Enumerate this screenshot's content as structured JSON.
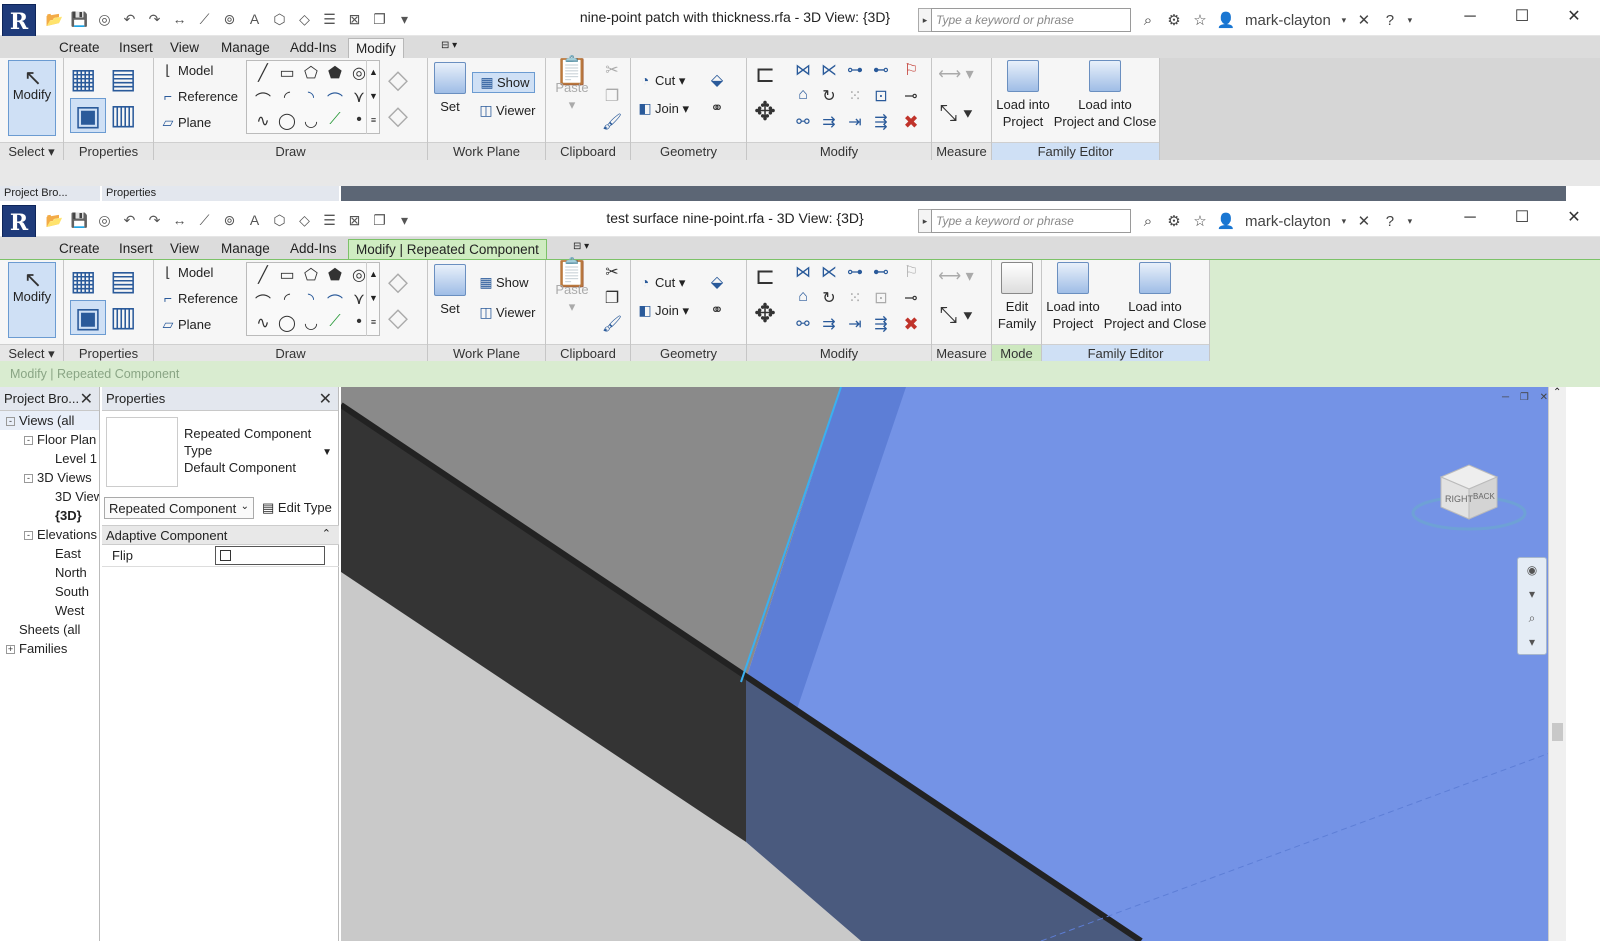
{
  "user": "mark-clayton",
  "search_placeholder": "Type a keyword or phrase",
  "qat_icons": [
    "open-icon",
    "save-icon",
    "sync-icon",
    "undo-icon",
    "redo-icon",
    "measure-icon",
    "dimension-icon",
    "tag-icon",
    "text-icon",
    "3d-view-icon",
    "section-icon",
    "thin-lines-icon",
    "close-hidden-icon",
    "switch-windows-icon",
    "customize-icon"
  ],
  "window1": {
    "title": "nine-point patch with thickness.rfa - 3D View: {3D}",
    "tabs": [
      "Create",
      "Insert",
      "View",
      "Manage",
      "Add-Ins",
      "Modify"
    ],
    "active_tab": "Modify",
    "browser_title": "Project Bro...",
    "properties_title": "Properties"
  },
  "window2": {
    "title": "test surface nine-point.rfa - 3D View: {3D}",
    "tabs": [
      "Create",
      "Insert",
      "View",
      "Manage",
      "Add-Ins"
    ],
    "active_tab": "Modify | Repeated Component",
    "options_bar": "Modify | Repeated Component",
    "browser_title": "Project Bro...",
    "properties_title": "Properties"
  },
  "ribbon": {
    "select": {
      "button": "Modify",
      "panel": "Select"
    },
    "properties": {
      "panel": "Properties"
    },
    "draw": {
      "panel": "Draw",
      "model": "Model",
      "reference": "Reference",
      "plane": "Plane"
    },
    "workplane": {
      "panel": "Work Plane",
      "set": "Set",
      "show": "Show",
      "viewer": "Viewer"
    },
    "clipboard": {
      "panel": "Clipboard",
      "paste": "Paste"
    },
    "geometry": {
      "panel": "Geometry",
      "cut": "Cut",
      "join": "Join"
    },
    "modify": {
      "panel": "Modify"
    },
    "measure": {
      "panel": "Measure"
    },
    "mode": {
      "panel": "Mode",
      "edit_family_1": "Edit",
      "edit_family_2": "Family"
    },
    "family_editor": {
      "panel": "Family Editor",
      "load_1": "Load into",
      "load_2": "Project",
      "load_close_1": "Load into",
      "load_close_2": "Project and Close"
    }
  },
  "project_browser": {
    "items": [
      {
        "label": "Views (all",
        "level": 0,
        "exp": "-"
      },
      {
        "label": "Floor Plan",
        "level": 1,
        "exp": "-"
      },
      {
        "label": "Level 1",
        "level": 2,
        "exp": ""
      },
      {
        "label": "3D Views",
        "level": 1,
        "exp": "-"
      },
      {
        "label": "3D View",
        "level": 2,
        "exp": ""
      },
      {
        "label": "{3D}",
        "level": 2,
        "exp": ""
      },
      {
        "label": "Elevations",
        "level": 1,
        "exp": "-"
      },
      {
        "label": "East",
        "level": 2,
        "exp": ""
      },
      {
        "label": "North",
        "level": 2,
        "exp": ""
      },
      {
        "label": "South",
        "level": 2,
        "exp": ""
      },
      {
        "label": "West",
        "level": 2,
        "exp": ""
      },
      {
        "label": "Sheets (all",
        "level": 0,
        "exp": ""
      },
      {
        "label": "Families",
        "level": 0,
        "exp": "+"
      }
    ]
  },
  "properties": {
    "type_line1": "Repeated Component",
    "type_line2": "Type",
    "type_line3": "Default Component",
    "selector": "Repeated Component",
    "edit_type": "Edit Type",
    "category": "Adaptive Component",
    "param_name": "Flip",
    "param_checked": false
  },
  "viewcube": {
    "right": "RIGHT",
    "back": "BACK"
  }
}
